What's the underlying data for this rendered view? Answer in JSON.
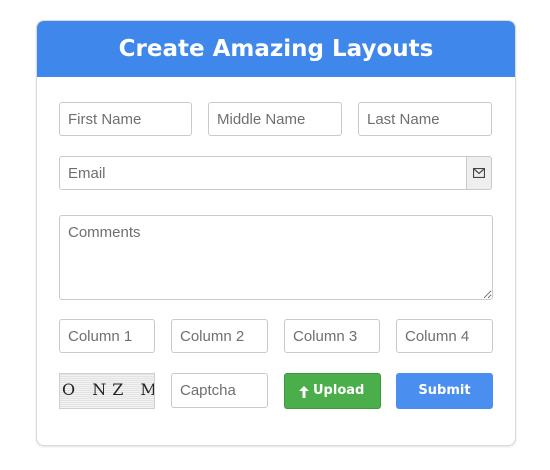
{
  "form": {
    "title": "Create Amazing Layouts",
    "first_name_placeholder": "First Name",
    "middle_name_placeholder": "Middle Name",
    "last_name_placeholder": "Last Name",
    "email_placeholder": "Email",
    "email_icon": "envelope-icon",
    "comments_placeholder": "Comments",
    "columns": [
      "Column 1",
      "Column 2",
      "Column 3",
      "Column 4"
    ],
    "captcha_image_text": "O NZ MU",
    "captcha_placeholder": "Captcha",
    "upload_label": "Upload",
    "upload_icon": "arrow-up-icon",
    "submit_label": "Submit"
  },
  "colors": {
    "header": "#3f87eb",
    "upload": "#4aae4a",
    "submit": "#4a8ff0"
  }
}
